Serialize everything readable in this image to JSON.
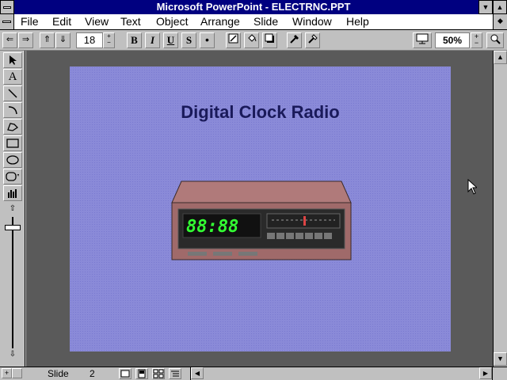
{
  "window": {
    "title": "Microsoft PowerPoint - ELECTRNC.PPT"
  },
  "menu": [
    "File",
    "Edit",
    "View",
    "Text",
    "Object",
    "Arrange",
    "Slide",
    "Window",
    "Help"
  ],
  "toolbar": {
    "font_size": "18",
    "bold_label": "B",
    "italic_label": "I",
    "underline_label": "U",
    "shadow_label": "S",
    "zoom": "50%"
  },
  "slide": {
    "title": "Digital Clock Radio",
    "clock_display": "88:88"
  },
  "status": {
    "label": "Slide",
    "number": "2"
  },
  "colors": {
    "titlebar": "#000080",
    "workspace": "#5a5a5a",
    "slide_background": "#8a8ad8",
    "clock_digits": "#33ff33"
  }
}
